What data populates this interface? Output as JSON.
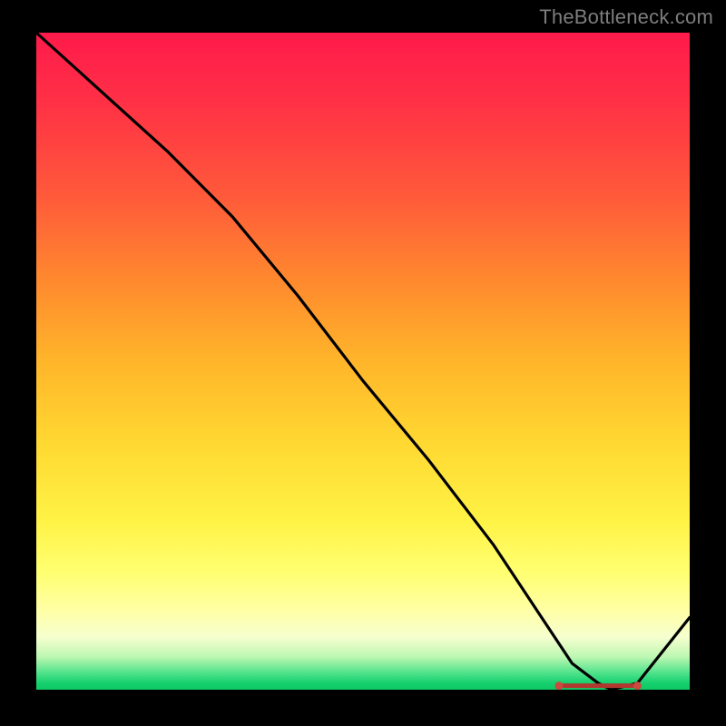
{
  "attribution": "TheBottleneck.com",
  "chart_data": {
    "type": "line",
    "title": "",
    "xlabel": "",
    "ylabel": "",
    "xlim": [
      0,
      100
    ],
    "ylim": [
      0,
      100
    ],
    "series": [
      {
        "name": "bottleneck-curve",
        "x": [
          0,
          10,
          20,
          25,
          30,
          40,
          50,
          60,
          70,
          78,
          82,
          86,
          88,
          92,
          100
        ],
        "values": [
          100,
          91,
          82,
          77,
          72,
          60,
          47,
          35,
          22,
          10,
          4,
          1,
          0,
          1,
          11
        ]
      }
    ],
    "optimal_range": {
      "x_start": 80,
      "x_end": 92,
      "y": 0.6
    },
    "grid": false,
    "legend": false,
    "colors": {
      "curve": "#000000",
      "marker": "#b1372f",
      "gradient_top": "#ff1a4b",
      "gradient_bottom": "#16d06e"
    }
  }
}
